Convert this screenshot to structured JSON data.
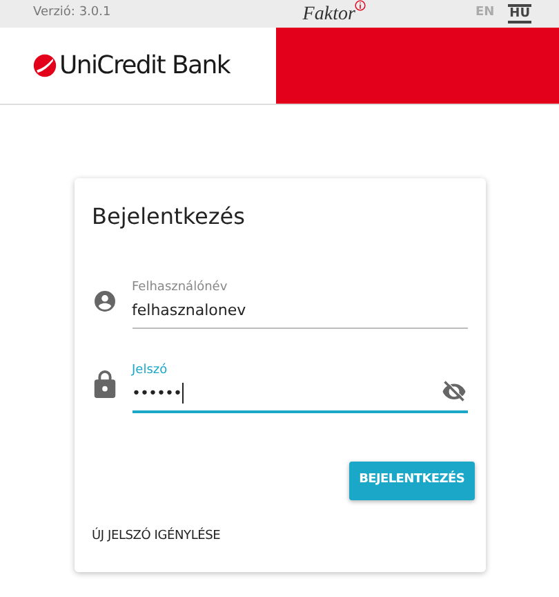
{
  "top_bar": {
    "version": "Verzió: 3.0.1",
    "product": "Faktor",
    "languages": [
      {
        "label": "EN",
        "selected": false
      },
      {
        "label": "HU",
        "selected": true
      }
    ]
  },
  "header": {
    "brand": "UniCredit Bank"
  },
  "login_card": {
    "title": "Bejelentkezés",
    "fields": [
      {
        "kind": "user",
        "label": "Felhasználónév",
        "value": "felhasznalonev",
        "focused": false
      },
      {
        "kind": "password",
        "label": "Jelszó",
        "value": "••••••",
        "focused": true
      }
    ],
    "submit": "BEJELENTKEZÉS",
    "reset_link": "ÚJ JELSZÓ IGÉNYLÉSE"
  }
}
